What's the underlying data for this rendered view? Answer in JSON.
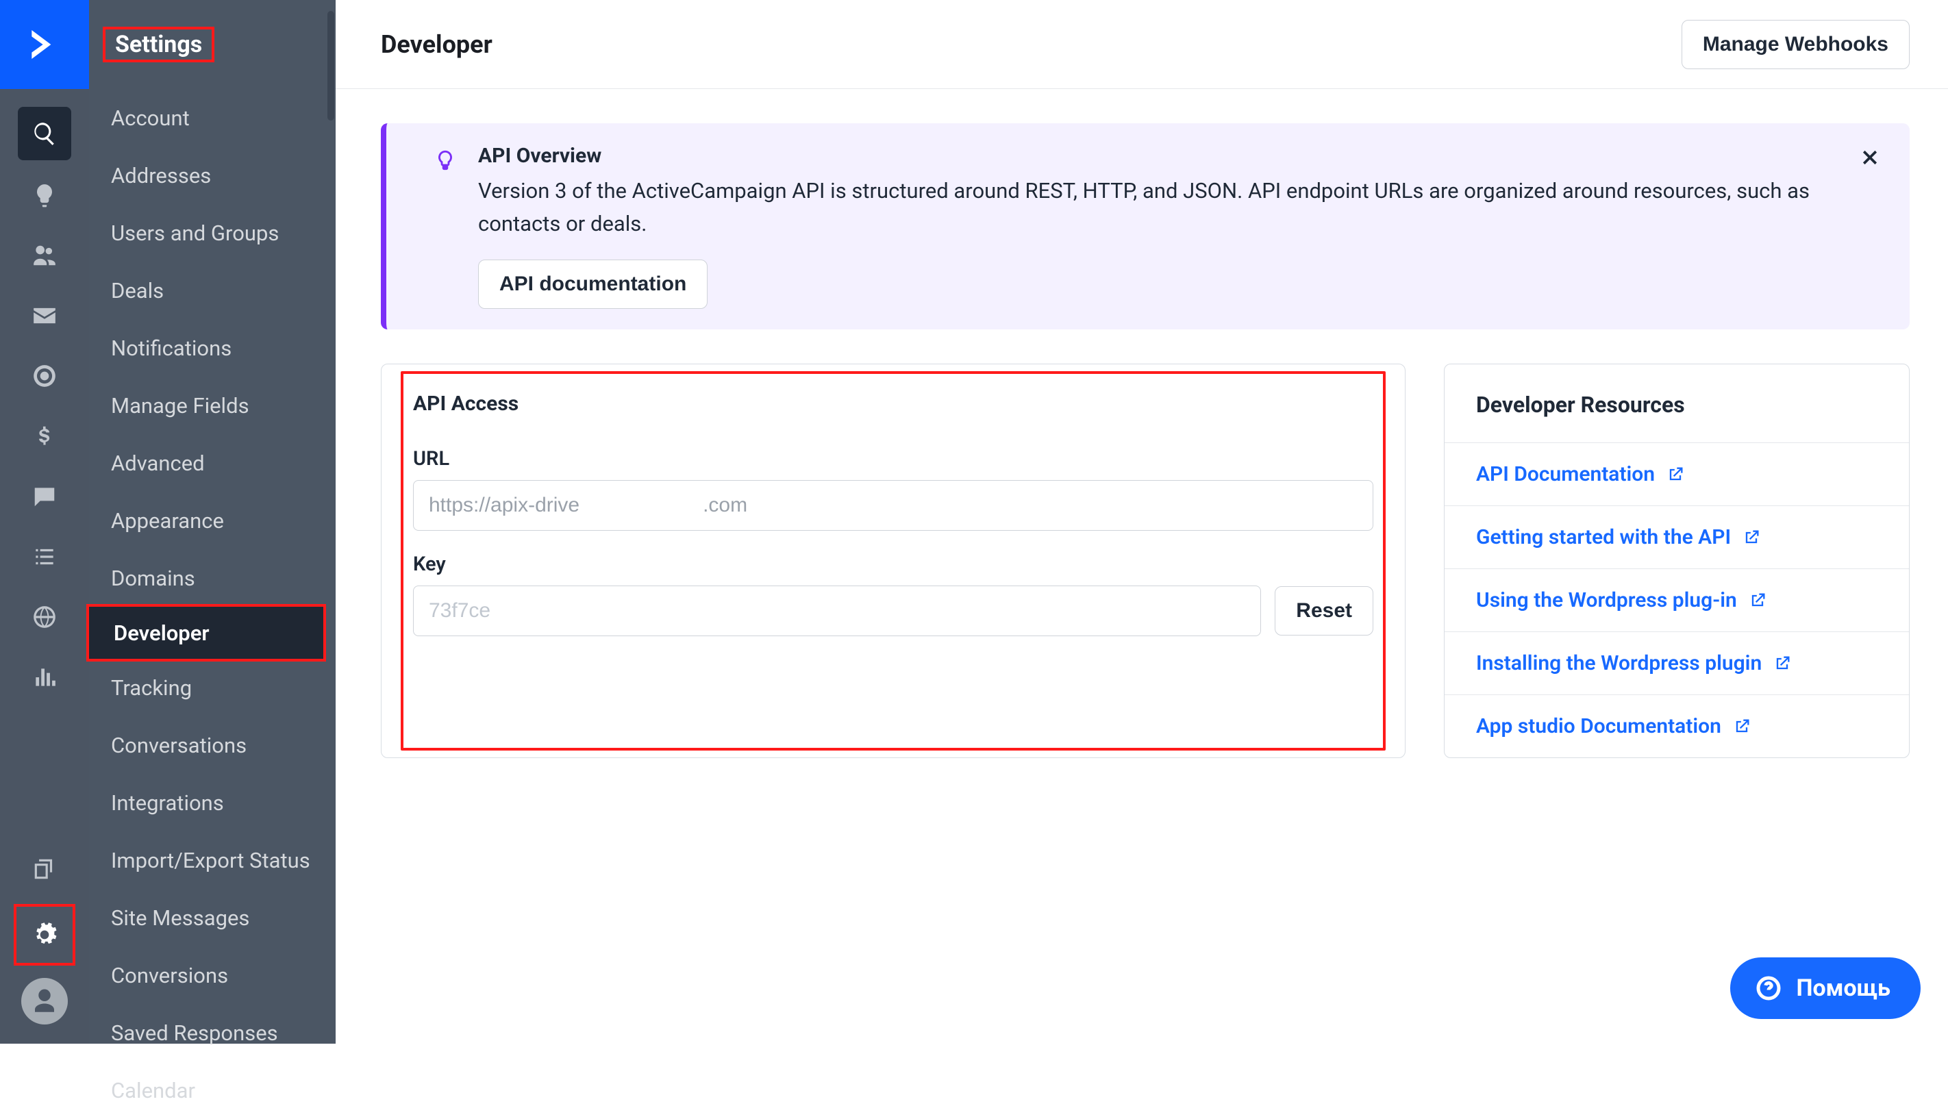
{
  "sidebar": {
    "title": "Settings",
    "items": [
      "Account",
      "Addresses",
      "Users and Groups",
      "Deals",
      "Notifications",
      "Manage Fields",
      "Advanced",
      "Appearance",
      "Domains",
      "Developer",
      "Tracking",
      "Conversations",
      "Integrations",
      "Import/Export Status",
      "Site Messages",
      "Conversions",
      "Saved Responses",
      "Calendar"
    ],
    "active_index": 9
  },
  "header": {
    "title": "Developer",
    "manage_webhooks": "Manage Webhooks"
  },
  "banner": {
    "title": "API Overview",
    "text": "Version 3 of the ActiveCampaign API is structured around REST, HTTP, and JSON. API endpoint URLs are organized around resources, such as contacts or deals.",
    "doc_button": "API documentation"
  },
  "api_access": {
    "panel_title": "API Access",
    "url_label": "URL",
    "url_value": "https://apix-drive      .com",
    "key_label": "Key",
    "key_value": "73f7ce",
    "reset_button": "Reset"
  },
  "resources": {
    "title": "Developer Resources",
    "links": [
      "API Documentation",
      "Getting started with the API",
      "Using the Wordpress plug-in",
      "Installing the Wordpress plugin",
      "App studio Documentation"
    ]
  },
  "help": {
    "label": "Помощь"
  }
}
